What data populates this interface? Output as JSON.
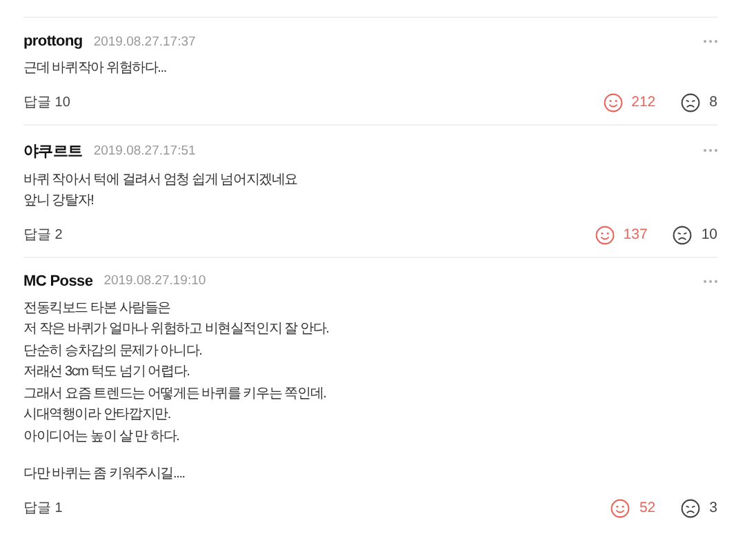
{
  "comments": [
    {
      "author": "prottong",
      "date": "2019.08.27.17:37",
      "paragraphs": [
        [
          "근데 바퀴작아 위험하다..."
        ]
      ],
      "replies": "답글 10",
      "likes": "212",
      "dislikes": "8"
    },
    {
      "author": "야쿠르트",
      "date": "2019.08.27.17:51",
      "paragraphs": [
        [
          "바퀴 작아서 턱에 걸려서 엄청 쉽게 넘어지겠네요",
          "앞니 강탈자!"
        ]
      ],
      "replies": "답글 2",
      "likes": "137",
      "dislikes": "10"
    },
    {
      "author": "MC Posse",
      "date": "2019.08.27.19:10",
      "paragraphs": [
        [
          "전동킥보드 타본 사람들은",
          "저 작은 바퀴가 얼마나 위험하고 비현실적인지 잘 안다.",
          "단순히 승차감의 문제가 아니다.",
          "저래선 3cm 턱도 넘기 어렵다.",
          "그래서 요즘 트렌드는 어떻게든 바퀴를 키우는 쪽인데.",
          "시대역행이라 안타깝지만.",
          "아이디어는 높이 살 만 하다."
        ],
        [
          "다만 바퀴는 좀 키워주시길...."
        ]
      ],
      "replies": "답글 1",
      "likes": "52",
      "dislikes": "3"
    }
  ]
}
